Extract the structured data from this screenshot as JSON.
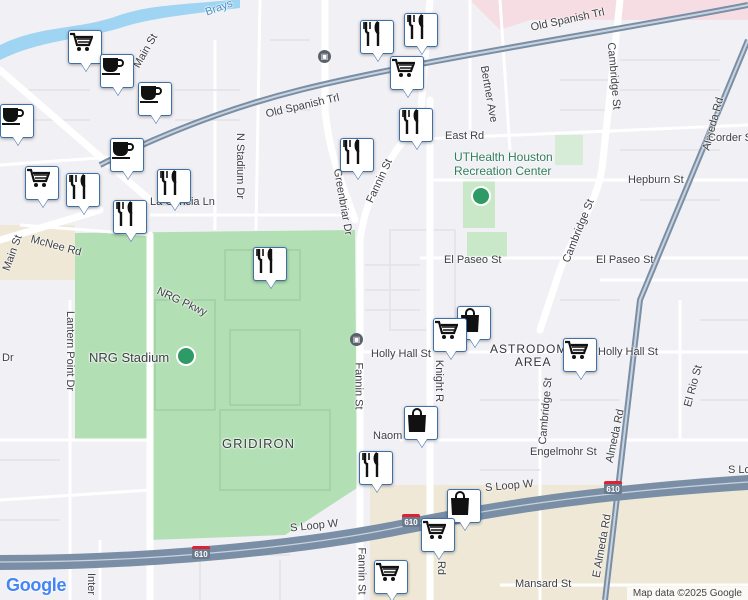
{
  "map": {
    "logo": "Google",
    "attribution": "Map data ©2025 Google",
    "colors": {
      "land": "#f1f0f4",
      "park": "#c8e8c8",
      "stadium_park": "#b2dfb3",
      "water": "#9fd4f2",
      "highway": "#7a8fa6",
      "road": "#ffffff",
      "urban_tan": "#efe8d6",
      "pin_border": "#3d6fa8"
    },
    "street_labels": {
      "old_spanish_trl_1": "Old Spanish Trl",
      "old_spanish_trl_2": "Old Spanish Trl",
      "fannin_st_1": "Fannin St",
      "fannin_st_2": "Fannin St",
      "fannin_st_3": "Fannin St",
      "greenbriar_dr": "Greenbriar Dr",
      "n_stadium_dr": "N Stadium Dr",
      "cambridge_st_1": "Cambridge St",
      "cambridge_st_2": "Cambridge St",
      "cambridge_st_3": "Cambridge St",
      "almeda_rd_1": "Almeda Rd",
      "almeda_rd_2": "Almeda Rd",
      "e_almeda_rd": "E Almeda Rd",
      "bertner_ave": "Bertner Ave",
      "east_rd": "East Rd",
      "hepburn_st": "Hepburn St",
      "corder_s": "Corder S",
      "el_paseo_st_1": "El Paseo St",
      "el_paseo_st_2": "El Paseo St",
      "holly_hall_st_1": "Holly Hall St",
      "holly_hall_st_2": "Holly Hall St",
      "knight_rd": "Knight R",
      "naom": "Naom",
      "engelmohr_st": "Engelmohr St",
      "el_rio_st": "El Rio St",
      "mansard_st": "Mansard St",
      "s_loop_w_1": "S Loop W",
      "s_loop_w_2": "S Loop W",
      "s_loop_1": "S Loop",
      "nrg_pkwy": "NRG Pkwy",
      "mcnee_rd": "McNee Rd",
      "la_concia_ln": "La Concia Ln",
      "lantern_point_dr": "Lantern Point Dr",
      "dr_left": "Dr",
      "main_st_top": "Main St",
      "main_st_left": "Main St",
      "inter": "Inter",
      "rd_bottom": "Rd",
      "braes": "Brays"
    },
    "area_labels": {
      "gridiron": "GRIDIRON",
      "astrodome_line1": "ASTRODOME",
      "astrodome_line2": "AREA"
    },
    "poi_labels": {
      "nrg_stadium": "NRG Stadium",
      "uthealth_line1": "UTHealth Houston",
      "uthealth_line2": "Recreation Center"
    },
    "highway_shields": [
      "610",
      "610",
      "610"
    ],
    "markers": [
      {
        "name": "marker-grocery-1",
        "icon": "grocery-cart-icon"
      },
      {
        "name": "marker-cafe-1",
        "icon": "coffee-cup-icon"
      },
      {
        "name": "marker-cafe-2",
        "icon": "coffee-cup-icon"
      },
      {
        "name": "marker-cafe-3",
        "icon": "coffee-cup-icon"
      },
      {
        "name": "marker-restaurant-1",
        "icon": "fork-knife-icon"
      },
      {
        "name": "marker-restaurant-2",
        "icon": "fork-knife-icon"
      },
      {
        "name": "marker-grocery-2",
        "icon": "grocery-cart-icon"
      },
      {
        "name": "marker-restaurant-3",
        "icon": "fork-knife-icon"
      },
      {
        "name": "marker-restaurant-4",
        "icon": "fork-knife-icon"
      },
      {
        "name": "marker-cafe-4",
        "icon": "coffee-cup-icon"
      },
      {
        "name": "marker-grocery-3",
        "icon": "grocery-cart-icon"
      },
      {
        "name": "marker-restaurant-5",
        "icon": "fork-knife-icon"
      },
      {
        "name": "marker-restaurant-6",
        "icon": "fork-knife-icon"
      },
      {
        "name": "marker-restaurant-7",
        "icon": "fork-knife-icon"
      },
      {
        "name": "marker-shopping-1",
        "icon": "shopping-bag-icon"
      },
      {
        "name": "marker-grocery-4",
        "icon": "grocery-cart-icon"
      },
      {
        "name": "marker-grocery-5",
        "icon": "grocery-cart-icon"
      },
      {
        "name": "marker-shopping-2",
        "icon": "shopping-bag-icon"
      },
      {
        "name": "marker-restaurant-8",
        "icon": "fork-knife-icon"
      },
      {
        "name": "marker-shopping-3",
        "icon": "shopping-bag-icon"
      },
      {
        "name": "marker-grocery-6",
        "icon": "grocery-cart-icon"
      },
      {
        "name": "marker-grocery-7",
        "icon": "grocery-cart-icon"
      },
      {
        "name": "marker-restaurant-9",
        "icon": "fork-knife-icon"
      }
    ]
  }
}
